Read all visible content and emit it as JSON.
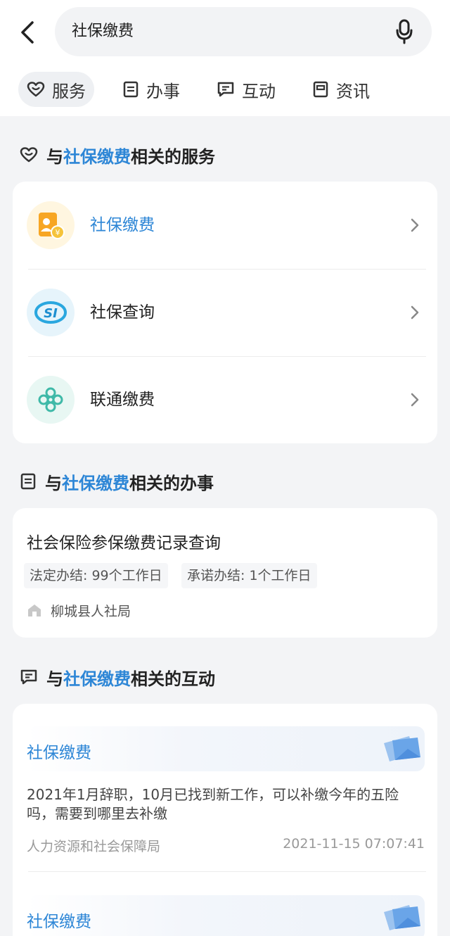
{
  "search": {
    "query": "社保缴费"
  },
  "tabs": [
    {
      "label": "服务",
      "icon": "heart-icon",
      "active": true
    },
    {
      "label": "办事",
      "icon": "document-icon",
      "active": false
    },
    {
      "label": "互动",
      "icon": "chat-icon",
      "active": false
    },
    {
      "label": "资讯",
      "icon": "news-icon",
      "active": false
    }
  ],
  "sections": {
    "prefix": "与",
    "keyword": "社保缴费",
    "services_suffix": "相关的服务",
    "affairs_suffix": "相关的办事",
    "interactions_suffix": "相关的互动"
  },
  "services": [
    {
      "label": "社保缴费",
      "icon": "social-security-payment-icon",
      "highlight": true
    },
    {
      "label": "社保查询",
      "icon": "si-logo-icon",
      "highlight": false
    },
    {
      "label": "联通缴费",
      "icon": "china-unicom-logo-icon",
      "highlight": false
    }
  ],
  "affair": {
    "title": "社会保险参保缴费记录查询",
    "legal_deadline": "法定办结: 99个工作日",
    "promised_deadline": "承诺办结: 1个工作日",
    "department": "柳城县人社局"
  },
  "interactions": [
    {
      "topic": "社保缴费",
      "question": "2021年1月辞职，10月已找到新工作，可以补缴今年的五险吗，需要到哪里去补缴",
      "department": "人力资源和社会保障局",
      "time": "2021-11-15 07:07:41"
    },
    {
      "topic": "社保缴费"
    }
  ],
  "colors": {
    "accent": "#2d86d6",
    "background": "#f3f4f6",
    "card": "#ffffff"
  }
}
